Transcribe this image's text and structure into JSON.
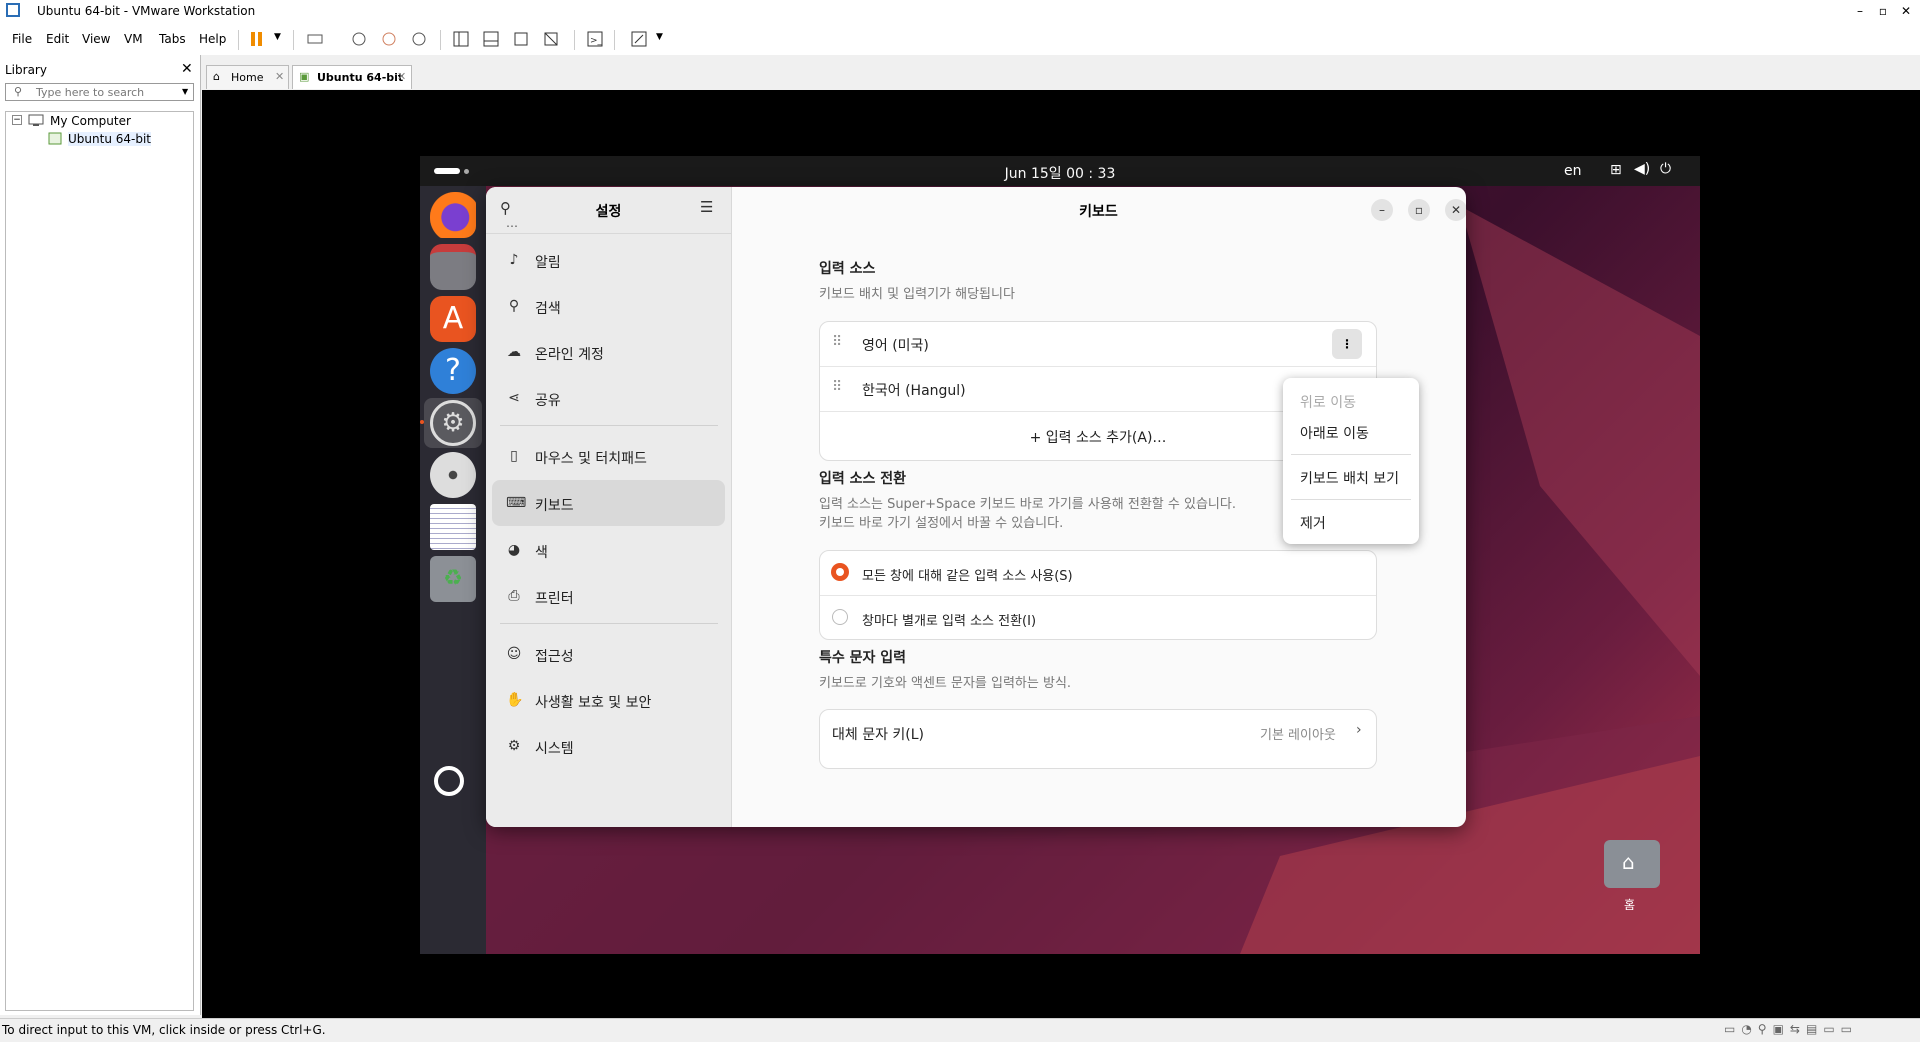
{
  "window": {
    "title": "Ubuntu 64-bit - VMware Workstation"
  },
  "menubar": {
    "items": [
      "File",
      "Edit",
      "View",
      "VM",
      "Tabs",
      "Help"
    ]
  },
  "library": {
    "title": "Library",
    "search_placeholder": "Type here to search",
    "tree": {
      "root": "My Computer",
      "child": "Ubuntu 64-bit"
    }
  },
  "tabs": [
    {
      "label": "Home"
    },
    {
      "label": "Ubuntu 64-bit"
    }
  ],
  "ubuntu": {
    "clock": "Jun 15일  00 : 33",
    "lang": "en",
    "desktop_home_label": "홈"
  },
  "settings": {
    "sidebar_title": "설정",
    "sidebar_items": [
      {
        "label": "알림",
        "icon": "bell-icon"
      },
      {
        "label": "검색",
        "icon": "search-icon"
      },
      {
        "label": "온라인 계정",
        "icon": "cloud-icon"
      },
      {
        "label": "공유",
        "icon": "share-icon"
      },
      {
        "label": "마우스 및 터치패드",
        "icon": "mouse-icon"
      },
      {
        "label": "키보드",
        "icon": "keyboard-icon"
      },
      {
        "label": "색",
        "icon": "color-icon"
      },
      {
        "label": "프린터",
        "icon": "printer-icon"
      },
      {
        "label": "접근성",
        "icon": "accessibility-icon"
      },
      {
        "label": "사생활 보호 및 보안",
        "icon": "hand-icon"
      },
      {
        "label": "시스템",
        "icon": "system-gear-icon"
      }
    ],
    "page_title": "키보드",
    "input_sources": {
      "heading": "입력 소스",
      "subtitle": "키보드 배치 및 입력기가 해당됩니다",
      "items": [
        "영어 (미국)",
        "한국어 (Hangul)"
      ],
      "add_label": "입력 소스 추가(A)…"
    },
    "switching": {
      "heading": "입력 소스 전환",
      "subtitle1": "입력 소스는 Super+Space 키보드 바로 가기를 사용해 전환할 수 있습니다.",
      "subtitle2": "키보드 바로 가기 설정에서 바꿀 수 있습니다.",
      "options": [
        "모든 창에 대해 같은 입력 소스 사용(S)",
        "창마다 별개로 입력 소스 전환(I)"
      ],
      "selected_index": 0
    },
    "special": {
      "heading": "특수 문자 입력",
      "subtitle": "키보드로 기호와 액센트 문자를 입력하는 방식.",
      "row_label": "대체 문자 키(L)",
      "row_value": "기본 레이아웃"
    },
    "popup": {
      "items": [
        "위로 이동",
        "아래로 이동",
        "키보드 배치 보기",
        "제거"
      ],
      "disabled_index": 0
    }
  },
  "statusbar": {
    "text": "To direct input to this VM, click inside or press Ctrl+G."
  },
  "colors": {
    "accent": "#e95420",
    "desktop": "#5a1838",
    "dock": "#2b2a33"
  }
}
